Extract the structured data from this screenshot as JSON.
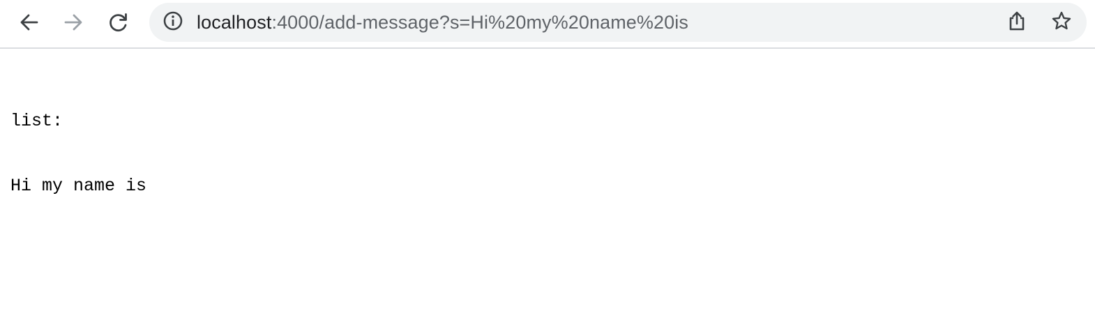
{
  "browser": {
    "url_host": "localhost",
    "url_path": ":4000/add-message?s=Hi%20my%20name%20is",
    "icons": {
      "back": "arrow-left-icon",
      "forward": "arrow-right-icon",
      "reload": "reload-icon",
      "site_info": "info-icon",
      "share": "share-icon",
      "bookmark": "star-icon"
    },
    "colors": {
      "omnibox_bg": "#f1f3f4",
      "host_text": "#202124",
      "path_text": "#5f6368",
      "disabled_icon": "#9aa0a6",
      "icon": "#3c4043"
    }
  },
  "page": {
    "lines": [
      "list:",
      "Hi my name is"
    ]
  }
}
